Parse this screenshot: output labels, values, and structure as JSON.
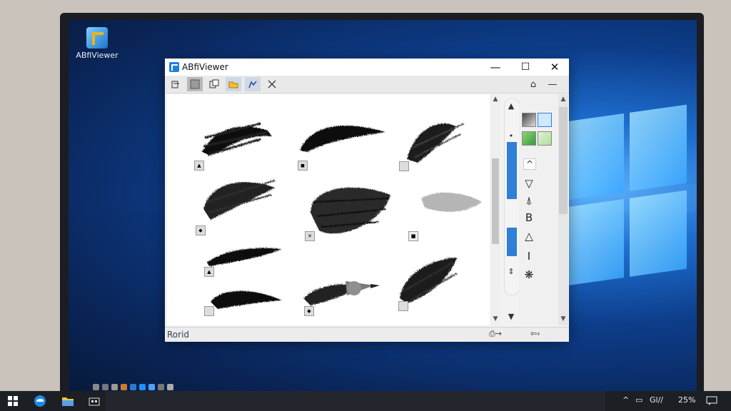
{
  "desktop": {
    "icon_label": "ABfiViewer"
  },
  "window": {
    "title": "ABfiViewer",
    "controls": {
      "minimize": "—",
      "maximize": "☐",
      "close": "✕"
    },
    "toolbar": {
      "icons": [
        "pages-icon",
        "square-icon",
        "copy-icon",
        "folder-icon",
        "pen-icon",
        "tools-icon"
      ],
      "right_icons": {
        "home": "⌂",
        "minimize_panel": "—"
      }
    },
    "side_tools": {
      "glyphs": [
        "^",
        "▽",
        "⍋",
        "B",
        "△",
        "I",
        "❋"
      ]
    },
    "status": {
      "text": "Rorid",
      "right_glyphs": [
        "⎙→",
        "⇦›"
      ]
    }
  },
  "taskbar": {
    "tray": {
      "caret": "^",
      "lang": "Gl//",
      "time": "25%"
    }
  },
  "colors": {
    "accent": "#2f7fd6",
    "window_bg": "#f2f2f2",
    "taskbar": "#1c1f24"
  }
}
